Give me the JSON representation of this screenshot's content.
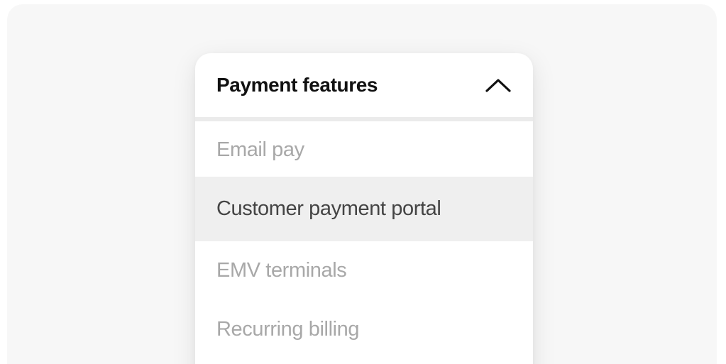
{
  "dropdown": {
    "title": "Payment features",
    "expanded": true,
    "toggle_icon": "chevron-up-icon",
    "items": [
      {
        "label": "Email pay",
        "active": false
      },
      {
        "label": "Customer payment portal",
        "active": true
      },
      {
        "label": "EMV terminals",
        "active": false
      },
      {
        "label": "Recurring billing",
        "active": false
      }
    ]
  },
  "colors": {
    "background": "#f7f7f7",
    "panel": "#ffffff",
    "title": "#111111",
    "item_muted": "#a8a8a8",
    "item_active_text": "#444444",
    "item_active_bg": "#efefef"
  }
}
